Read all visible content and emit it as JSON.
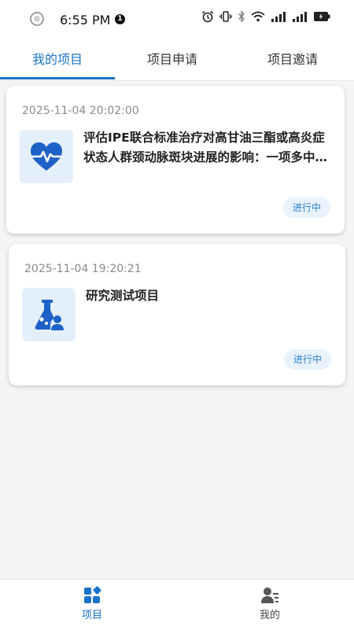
{
  "status_bar": {
    "time": "6:55 PM",
    "notification_count": "1",
    "icons": [
      "alarm-icon",
      "vibrate-icon",
      "bluetooth-icon",
      "wifi-icon",
      "signal-icon",
      "signal-icon",
      "battery-icon"
    ]
  },
  "tabs": [
    {
      "label": "我的项目",
      "active": true
    },
    {
      "label": "项目申请",
      "active": false
    },
    {
      "label": "项目邀请",
      "active": false
    }
  ],
  "colors": {
    "accent": "#1a73c9",
    "status_bg": "#e8f3fd",
    "status_text": "#2a7fd0",
    "icon_bg": "#e3f0fc"
  },
  "projects": [
    {
      "date": "2025-11-04 20:02:00",
      "title": "评估IPE联合标准治疗对高甘油三酯或高炎症状态人群颈动脉斑块进展的影响：一项多中心研究",
      "status": "进行中",
      "icon": "heart-pulse-icon"
    },
    {
      "date": "2025-11-04 19:20:21",
      "title": "研究测试项目",
      "status": "进行中",
      "icon": "flask-user-icon"
    }
  ],
  "bottom_nav": [
    {
      "label": "项目",
      "icon": "grid-icon",
      "active": true
    },
    {
      "label": "我的",
      "icon": "user-list-icon",
      "active": false
    }
  ]
}
